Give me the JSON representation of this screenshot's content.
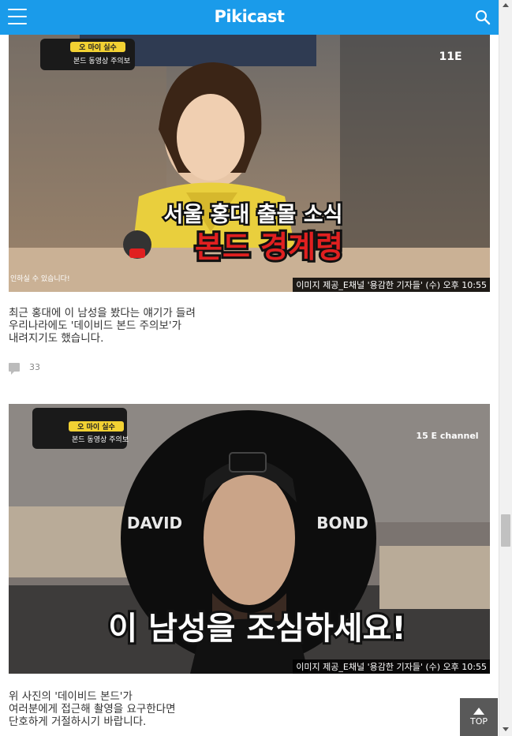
{
  "header": {
    "logo": "Pikicast",
    "menu_icon": "hamburger-icon",
    "search_icon": "search-icon",
    "color": "#1a9bea"
  },
  "posts": [
    {
      "image_overlay_top_left": "오 마이 실수",
      "image_overlay_sub": "본드 동영상 주의보",
      "image_title_line1": "서울 홍대 출몰 소식",
      "image_title_line2": "본드 경계령",
      "image_channel_badge": "11E",
      "image_left_caption": "인하실 수 있습니다!",
      "credit": "이미지 제공_E채널 '용감한 기자들' (수) 오후 10:55",
      "text": "최근 홍대에 이 남성을 봤다는 얘기가 들려\n우리나라에도 '데이비드 본드 주의보'가\n내려지기도 했습니다.",
      "comment_count": "33"
    },
    {
      "image_overlay_top_left": "오 마이 실수",
      "image_overlay_sub": "본드 동영상 주의보",
      "image_name_left": "DAVID",
      "image_name_right": "BOND",
      "image_title": "이 남성을 조심하세요!",
      "image_channel_badge": "15 E channel",
      "credit": "이미지 제공_E채널 '용감한 기자들' (수) 오후 10:55",
      "text": "위 사진의 '데이비드 본드'가\n여러분에게 접근해 촬영을 요구한다면\n단호하게 거절하시기 바랍니다."
    }
  ],
  "top_button": {
    "label": "TOP"
  }
}
